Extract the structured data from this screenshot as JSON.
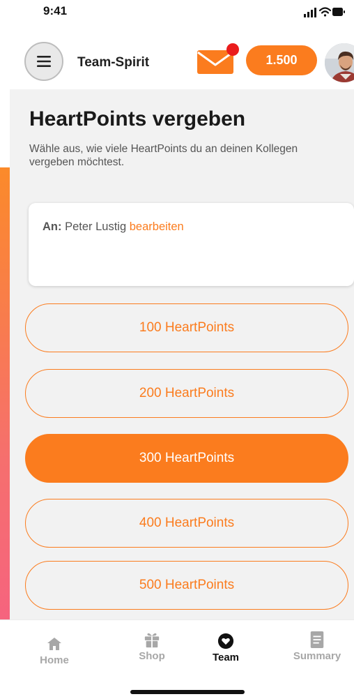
{
  "status_bar": {
    "time": "9:41"
  },
  "header": {
    "title": "Team-Spirit",
    "points_balance": "1.500",
    "has_unread_mail": true
  },
  "main": {
    "title": "HeartPoints vergeben",
    "subtitle": "Wähle aus, wie viele HeartPoints du an deinen Kollegen vergeben möchtest.",
    "recipient": {
      "prefix": "An:",
      "name": "Peter Lustig",
      "edit_label": "bearbeiten"
    },
    "options": [
      {
        "label": "100 HeartPoints",
        "selected": false
      },
      {
        "label": "200 HeartPoints",
        "selected": false
      },
      {
        "label": "300 HeartPoints",
        "selected": true
      },
      {
        "label": "400 HeartPoints",
        "selected": false
      },
      {
        "label": "500 HeartPoints",
        "selected": false
      }
    ]
  },
  "tabbar": {
    "tabs": [
      {
        "label": "Home",
        "icon": "home-icon",
        "active": false
      },
      {
        "label": "Shop",
        "icon": "gift-icon",
        "active": false
      },
      {
        "label": "Team",
        "icon": "heart-icon",
        "active": true
      },
      {
        "label": "Summary",
        "icon": "document-icon",
        "active": false
      }
    ]
  },
  "colors": {
    "accent": "#fb7c1e",
    "notification": "#ea1c1c",
    "background": "#f2f2f2"
  }
}
